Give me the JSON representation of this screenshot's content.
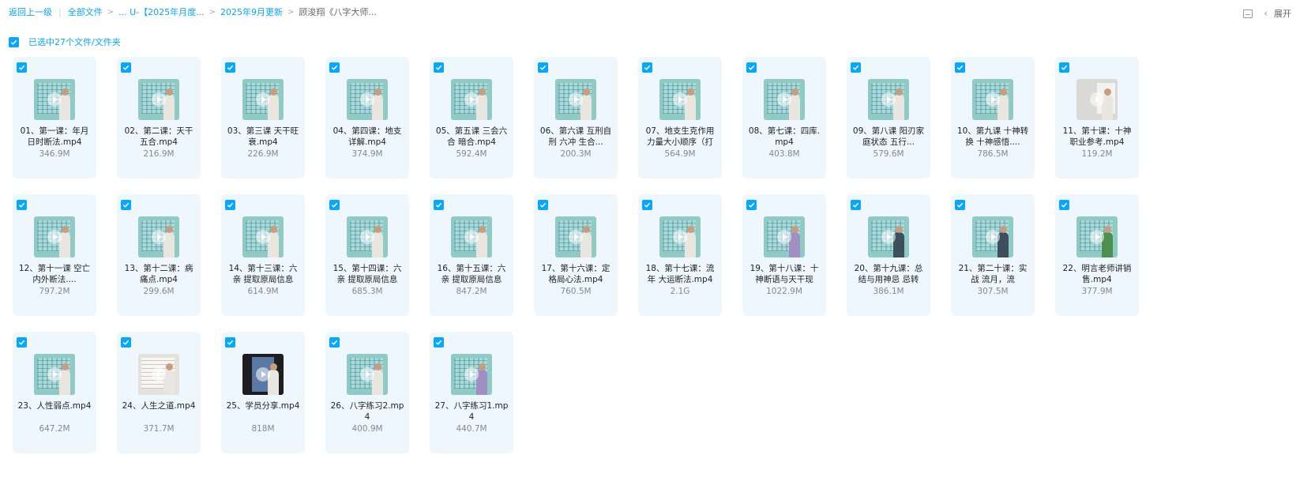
{
  "breadcrumb": {
    "back": "返回上一级",
    "all_files": "全部文件",
    "folder1": "... U-【2025年月度...",
    "folder2": "2025年9月更新",
    "current": "顾浚翔《八字大师..."
  },
  "toolbar": {
    "list_view_icon": "list-view-icon",
    "expand_label": "展开"
  },
  "selection": {
    "label": "已选中27个文件/文件夹",
    "checked": true
  },
  "colors": {
    "accent": "#06a7ff",
    "card_bg": "#eef7fd"
  },
  "files": [
    {
      "name": "01、第一课：年月日时断法.mp4",
      "size": "346.9M"
    },
    {
      "name": "02、第二课：天干五合.mp4",
      "size": "216.9M"
    },
    {
      "name": "03、第三课 天干旺衰.mp4",
      "size": "226.9M"
    },
    {
      "name": "04、第四课：地支详解.mp4",
      "size": "374.9M"
    },
    {
      "name": "05、第五课 三会六合 暗合.mp4",
      "size": "592.4M"
    },
    {
      "name": "06、第六课 互刑自刑 六冲 生合...",
      "size": "200.3M"
    },
    {
      "name": "07、地支生克作用力量大小顺序（打",
      "size": "564.9M"
    },
    {
      "name": "08、第七课：四库.mp4",
      "size": "403.8M"
    },
    {
      "name": "09、第八课 阳刃家庭状态 五行...",
      "size": "579.6M"
    },
    {
      "name": "10、第九课 十神转换 十神感悟....",
      "size": "786.5M"
    },
    {
      "name": "11、第十课：十神职业参考.mp4",
      "size": "119.2M"
    },
    {
      "name": "12、第十一课 空亡 内外断法....",
      "size": "797.2M"
    },
    {
      "name": "13、第十二课：病痛点.mp4",
      "size": "299.6M"
    },
    {
      "name": "14、第十三课：六亲 提取原局信息",
      "size": "614.9M"
    },
    {
      "name": "15、第十四课：六亲 提取原局信息",
      "size": "685.3M"
    },
    {
      "name": "16、第十五课：六亲 提取原局信息",
      "size": "847.2M"
    },
    {
      "name": "17、第十六课：定格局心法.mp4",
      "size": "760.5M"
    },
    {
      "name": "18、第十七课：流年 大运断法.mp4",
      "size": "2.1G"
    },
    {
      "name": "19、第十八课：十神断语与天干现",
      "size": "1022.9M"
    },
    {
      "name": "20、第十九课：总结与用神忌 忌转",
      "size": "386.1M"
    },
    {
      "name": "21、第二十课：实战 流月，流",
      "size": "307.5M"
    },
    {
      "name": "22、明言老师讲销售.mp4",
      "size": "377.9M"
    },
    {
      "name": "23、人性弱点.mp4",
      "size": "647.2M"
    },
    {
      "name": "24、人生之道.mp4",
      "size": "371.7M"
    },
    {
      "name": "25、学员分享.mp4",
      "size": "818M"
    },
    {
      "name": "26、八字练习2.mp4",
      "size": "400.9M"
    },
    {
      "name": "27、八字练习1.mp4",
      "size": "440.7M"
    }
  ]
}
